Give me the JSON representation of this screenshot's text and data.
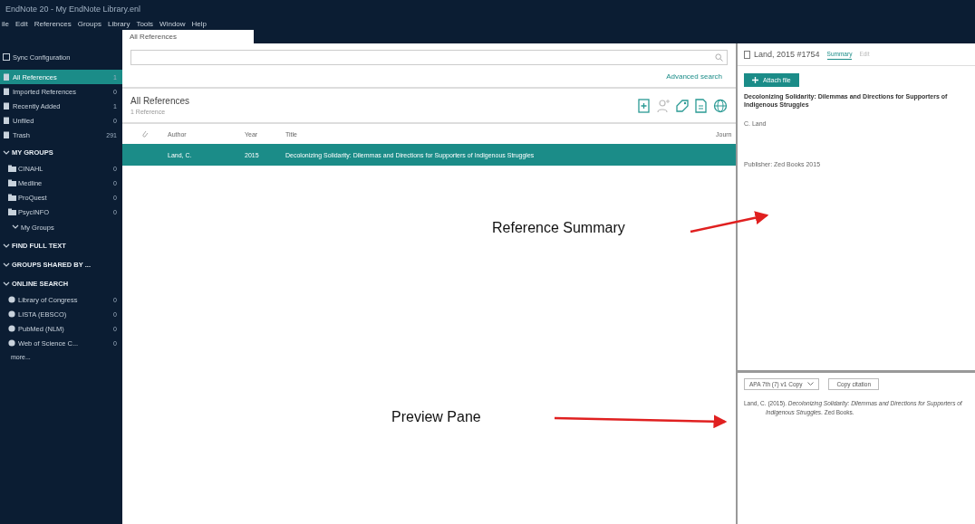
{
  "window": {
    "title": "EndNote 20 - My EndNote Library.enl"
  },
  "menu": [
    "ile",
    "Edit",
    "References",
    "Groups",
    "Library",
    "Tools",
    "Window",
    "Help"
  ],
  "tabs": [
    {
      "label": "All References",
      "selected": true
    }
  ],
  "sidebar": {
    "items": [
      {
        "kind": "sync",
        "label": "Sync Configuration"
      },
      {
        "kind": "library",
        "label": "All References",
        "count": "1",
        "selected": true
      },
      {
        "kind": "library",
        "label": "Imported References",
        "count": "0",
        "selected": false
      },
      {
        "kind": "library",
        "label": "Recently Added",
        "count": "1",
        "selected": false
      },
      {
        "kind": "library",
        "label": "Unfiled",
        "count": "0",
        "selected": false
      },
      {
        "kind": "library",
        "label": "Trash",
        "count": "291",
        "selected": false
      },
      {
        "kind": "section",
        "label": "MY GROUPS",
        "expanded": true,
        "children": [
          {
            "kind": "group",
            "label": "CINAHL",
            "count": "0",
            "selected": false
          },
          {
            "kind": "group",
            "label": "Medline",
            "count": "0",
            "selected": false
          },
          {
            "kind": "group",
            "label": "ProQuest",
            "count": "0",
            "selected": false
          },
          {
            "kind": "group",
            "label": "PsycINFO",
            "count": "0",
            "selected": false
          },
          {
            "kind": "subsection",
            "label": "My Groups",
            "expanded": true
          }
        ]
      },
      {
        "kind": "section",
        "label": "FIND FULL TEXT",
        "expanded": true
      },
      {
        "kind": "section",
        "label": "GROUPS SHARED BY ...",
        "expanded": true
      },
      {
        "kind": "section",
        "label": "ONLINE SEARCH",
        "expanded": true,
        "children": [
          {
            "kind": "online",
            "label": "Library of Congress",
            "count": "0",
            "selected": false
          },
          {
            "kind": "online",
            "label": "LISTA (EBSCO)",
            "count": "0",
            "selected": false
          },
          {
            "kind": "online",
            "label": "PubMed (NLM)",
            "count": "0",
            "selected": false
          },
          {
            "kind": "online",
            "label": "Web of Science C...",
            "count": "0",
            "selected": false
          },
          {
            "kind": "more",
            "label": "more..."
          }
        ]
      }
    ]
  },
  "search": {
    "advanced_link": "Advanced search"
  },
  "list_header": {
    "title": "All References",
    "subtitle": "1 Reference"
  },
  "table": {
    "columns": [
      "",
      "Author",
      "Year",
      "Title",
      "Journ"
    ],
    "rows": [
      {
        "author": "Land, C.",
        "year": "2015",
        "title": "Decolonizing Solidarity: Dilemmas and Directions for Supporters of Indigenous Struggles",
        "selected": true
      }
    ]
  },
  "reference_panel": {
    "label": "Land, 2015 #1754",
    "tabs": [
      {
        "label": "Summary",
        "selected": true
      },
      {
        "label": "Edit",
        "selected": false
      }
    ],
    "attach_button": "Attach file",
    "title": "Decolonizing Solidarity: Dilemmas and Directions for Supporters of Indigenous Struggles",
    "author": "C. Land",
    "publisher": "Publisher: Zed Books 2015"
  },
  "preview": {
    "style": "APA 7th (7) v1 Copy",
    "copy_button": "Copy citation",
    "citation": "Land, C. (2015). *Decolonizing Solidarity: Dilemmas and Directions for Supporters of Indigenous Struggles*. Zed Books."
  },
  "annotations": [
    {
      "text": "Reference Summary"
    },
    {
      "text": "Preview Pane"
    }
  ]
}
